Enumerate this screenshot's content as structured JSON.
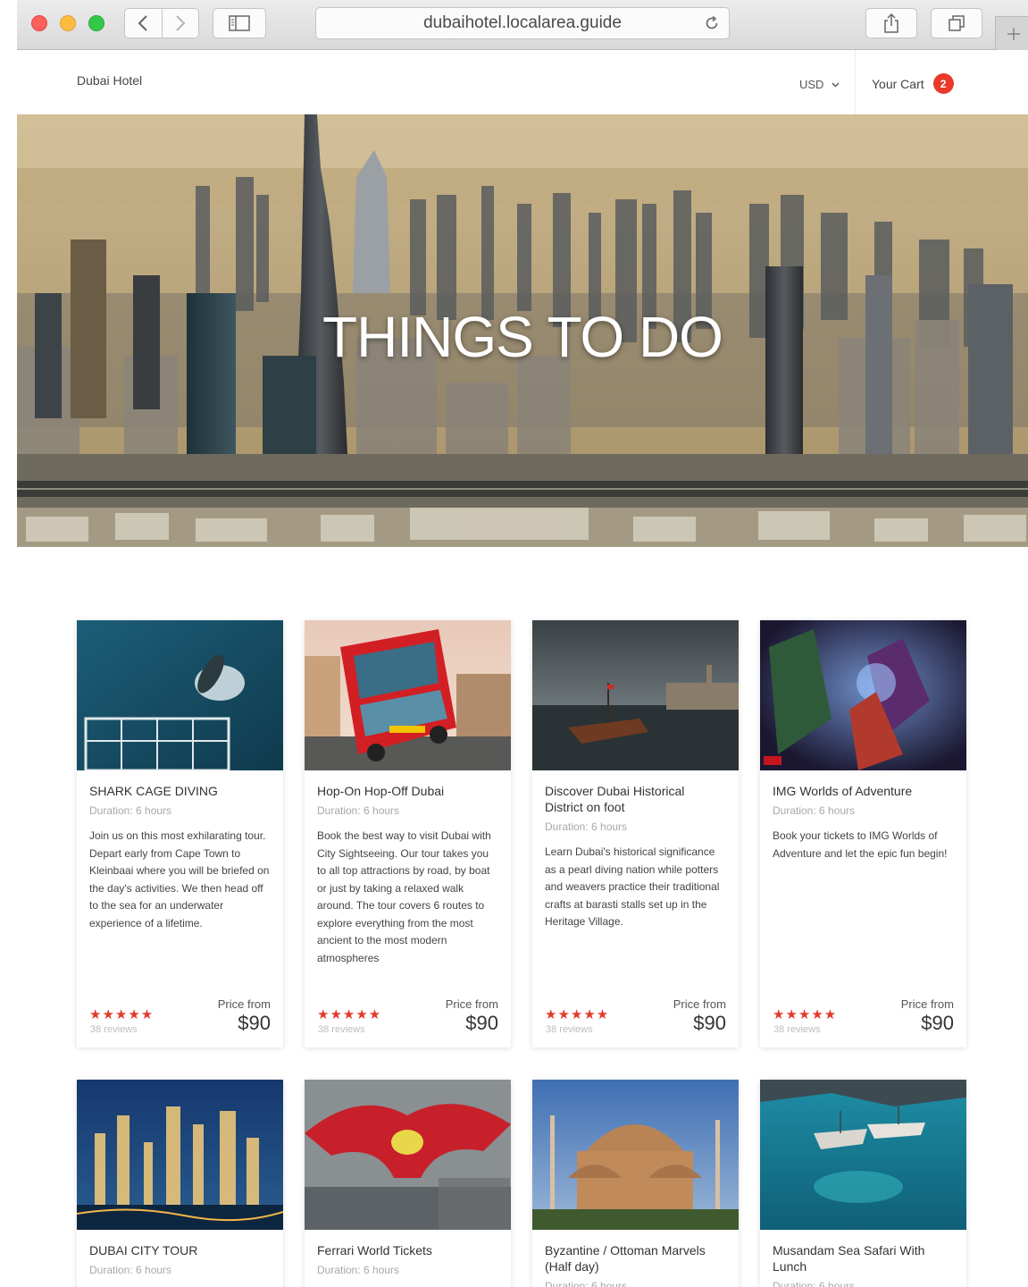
{
  "browser": {
    "url": "dubaihotel.localarea.guide"
  },
  "header": {
    "brand": "Dubai Hotel",
    "currency": "USD",
    "cart_label": "Your Cart",
    "cart_count": "2"
  },
  "hero": {
    "title": "THINGS TO DO"
  },
  "cards": [
    {
      "title": "SHARK CAGE DIVING",
      "duration": "Duration: 6 hours",
      "description": "Join us on this most exhilarating tour. Depart early from Cape Town to Kleinbaai where you will be briefed on the day's activities. We then head off to the sea for an underwater experience of a lifetime.",
      "stars": "★★★★★",
      "reviews": "38 reviews",
      "price_from": "Price from",
      "price": "$90"
    },
    {
      "title": "Hop-On Hop-Off Dubai",
      "duration": "Duration: 6 hours",
      "description": "Book the best way to visit Dubai with City Sightseeing. Our tour takes you to all top attractions by road, by boat or just by taking a relaxed walk around. The tour covers 6 routes to explore everything from the most ancient to the most modern atmospheres",
      "stars": "★★★★★",
      "reviews": "38 reviews",
      "price_from": "Price from",
      "price": "$90"
    },
    {
      "title": "Discover Dubai Historical District on foot",
      "duration": "Duration: 6 hours",
      "description": "Learn Dubai's historical significance as a pearl diving nation while potters and weavers practice their traditional crafts at barasti stalls set up in the Heritage Village.",
      "stars": "★★★★★",
      "reviews": "38 reviews",
      "price_from": "Price from",
      "price": "$90"
    },
    {
      "title": "IMG Worlds of Adventure",
      "duration": "Duration: 6 hours",
      "description": "Book your tickets to IMG Worlds of Adventure and let the epic fun begin!",
      "stars": "★★★★★",
      "reviews": "38 reviews",
      "price_from": "Price from",
      "price": "$90"
    },
    {
      "title": "DUBAI CITY TOUR",
      "duration": "Duration: 6 hours"
    },
    {
      "title": "Ferrari World Tickets",
      "duration": "Duration: 6 hours"
    },
    {
      "title": "Byzantine / Ottoman Marvels (Half day)",
      "duration": "Duration: 6 hours"
    },
    {
      "title": "Musandam Sea Safari With Lunch",
      "duration": "Duration: 6 hours"
    }
  ],
  "colors": {
    "accent_red": "#e8392b",
    "star_red": "#e23a2d"
  }
}
